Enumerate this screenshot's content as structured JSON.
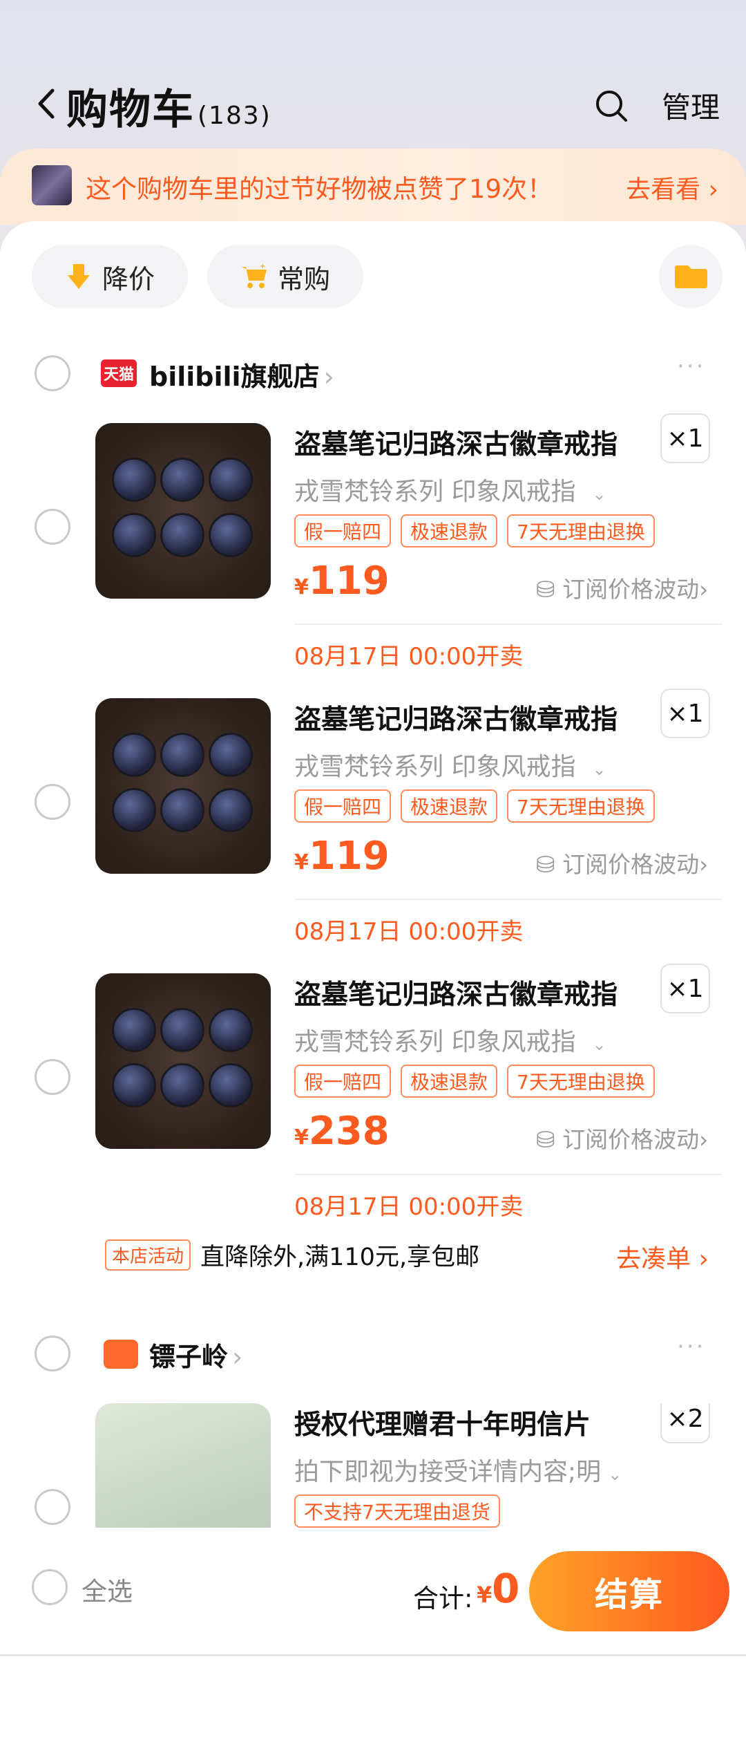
{
  "header": {
    "title": "购物车",
    "count": "(183)",
    "manage": "管理"
  },
  "promo": {
    "text": "这个购物车里的过节好物被点赞了19次！",
    "link": "去看看"
  },
  "filters": [
    {
      "label": "降价"
    },
    {
      "label": "常购"
    }
  ],
  "store1": {
    "logo_text": "天猫",
    "name": "bilibili旗舰店",
    "more": "···",
    "items": [
      {
        "title": "盗墓笔记归路深古徽章戒指",
        "qty": "×1",
        "variant": "戎雪梵铃系列 印象风戒指",
        "tags": [
          "假一赔四",
          "极速退款",
          "7天无理由退换"
        ],
        "currency": "¥",
        "price": "119",
        "watch": "订阅价格波动",
        "sale_time": "08月17日 00:00开卖"
      },
      {
        "title": "盗墓笔记归路深古徽章戒指",
        "qty": "×1",
        "variant": "戎雪梵铃系列 印象风戒指",
        "tags": [
          "假一赔四",
          "极速退款",
          "7天无理由退换"
        ],
        "currency": "¥",
        "price": "119",
        "watch": "订阅价格波动",
        "sale_time": "08月17日 00:00开卖"
      },
      {
        "title": "盗墓笔记归路深古徽章戒指",
        "qty": "×1",
        "variant": "戎雪梵铃系列 印象风戒指",
        "tags": [
          "假一赔四",
          "极速退款",
          "7天无理由退换"
        ],
        "currency": "¥",
        "price": "238",
        "watch": "订阅价格波动",
        "sale_time": "08月17日 00:00开卖"
      }
    ],
    "activity_badge": "本店活动",
    "activity_text": "直降除外,满110元,享包邮",
    "gather": "去凑单 ›"
  },
  "store2": {
    "name": "镖子岭",
    "more": "···",
    "item": {
      "title": "授权代理赠君十年明信片",
      "qty": "×2",
      "variant": "拍下即视为接受详情内容;明",
      "tag": "不支持7天无理由退货"
    }
  },
  "bottom": {
    "select_all": "全选",
    "total_label": "合计:",
    "currency": "¥",
    "total": "0",
    "checkout": "结算"
  },
  "colors": {
    "accent": "#ff5a1f",
    "checkout_start": "#ffa228",
    "tmall_red": "#e8232f"
  }
}
